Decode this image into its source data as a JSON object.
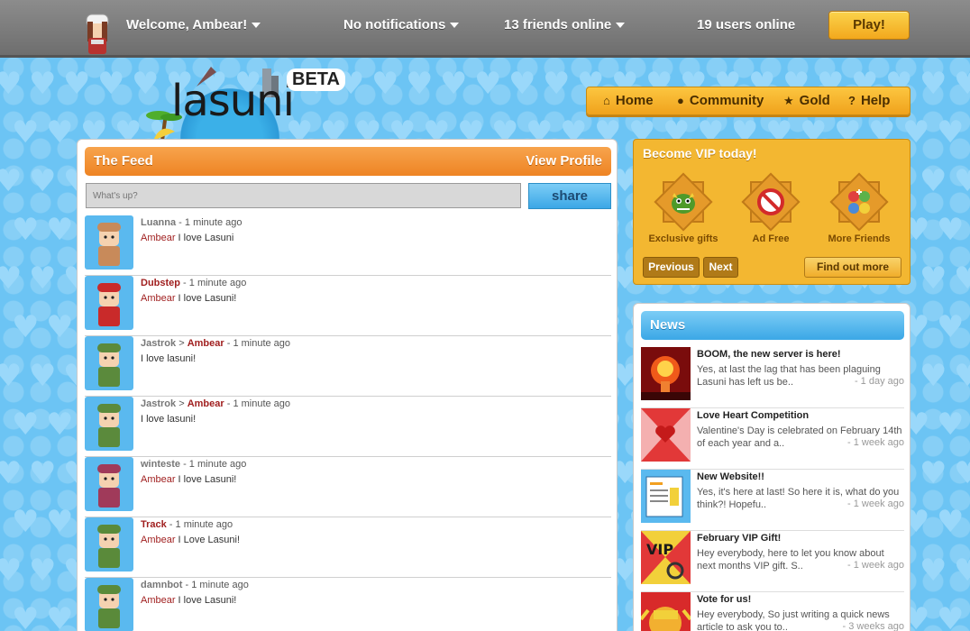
{
  "topbar": {
    "welcome": "Welcome, Ambear!",
    "notifications": "No notifications",
    "friends_online": "13 friends online",
    "users_online": "19 users online",
    "play_label": "Play!"
  },
  "logo": {
    "text": "lasuni",
    "badge": "BETA"
  },
  "nav": {
    "items": [
      {
        "label": "Home",
        "icon": "home-icon"
      },
      {
        "label": "Community",
        "icon": "person-icon"
      },
      {
        "label": "Gold",
        "icon": "star-icon"
      },
      {
        "label": "Help",
        "icon": "question-icon"
      }
    ]
  },
  "feed": {
    "title": "The Feed",
    "view_profile": "View Profile",
    "input_placeholder": "What's up?",
    "share_label": "share",
    "items": [
      {
        "author": "Luanna",
        "author_highlight": false,
        "to": "",
        "time": "1 minute ago",
        "recipient": "Ambear",
        "message": "I love Lasuni",
        "avatar_color": "#c88a5a"
      },
      {
        "author": "Dubstep",
        "author_highlight": true,
        "to": "",
        "time": "1 minute ago",
        "recipient": "Ambear",
        "message": "I love Lasuni!",
        "avatar_color": "#c92a2a"
      },
      {
        "author": "Jastrok",
        "author_highlight": false,
        "to": "Ambear",
        "time": "1 minute ago",
        "recipient": "",
        "message": "I love lasuni!",
        "avatar_color": "#5b8a3c"
      },
      {
        "author": "Jastrok",
        "author_highlight": false,
        "to": "Ambear",
        "time": "1 minute ago",
        "recipient": "",
        "message": "I love lasuni!",
        "avatar_color": "#5b8a3c"
      },
      {
        "author": "winteste",
        "author_highlight": false,
        "to": "",
        "time": "1 minute ago",
        "recipient": "Ambear",
        "message": "I love Lasuni!",
        "avatar_color": "#a03a5a"
      },
      {
        "author": "Track",
        "author_highlight": true,
        "to": "",
        "time": "1 minute ago",
        "recipient": "Ambear",
        "message": "I Love Lasuni!",
        "avatar_color": "#5a8a3a"
      },
      {
        "author": "damnbot",
        "author_highlight": false,
        "to": "",
        "time": "1 minute ago",
        "recipient": "Ambear",
        "message": "I love Lasuni!",
        "avatar_color": "#5a8a3a"
      }
    ]
  },
  "vip": {
    "title": "Become VIP today!",
    "items": [
      {
        "label": "Exclusive gifts",
        "icon": "dragon-icon"
      },
      {
        "label": "Ad Free",
        "icon": "no-ads-icon"
      },
      {
        "label": "More Friends",
        "icon": "friends-icon"
      }
    ],
    "previous_label": "Previous",
    "next_label": "Next",
    "find_out_label": "Find out more"
  },
  "news": {
    "title": "News",
    "items": [
      {
        "title": "BOOM, the new server is here!",
        "excerpt": "Yes, at last the lag that has been plaguing Lasuni has left us be..",
        "ago": "- 1 day ago",
        "thumb": "explosion-icon"
      },
      {
        "title": "Love Heart Competition",
        "excerpt": "Valentine's Day is celebrated on February 14th of each year and a..",
        "ago": "- 1 week ago",
        "thumb": "heart-icon"
      },
      {
        "title": "New Website!!",
        "excerpt": "Yes, it's here at last! So here it is, what do you think?! Hopefu..",
        "ago": "- 1 week ago",
        "thumb": "website-icon"
      },
      {
        "title": "February VIP Gift!",
        "excerpt": "Hey everybody, here to let you know about next months VIP gift. S..",
        "ago": "- 1 week ago",
        "thumb": "vip-gift-icon"
      },
      {
        "title": "Vote for us!",
        "excerpt": "Hey everybody, So just writing a quick news article to ask you to..",
        "ago": "- 3 weeks ago",
        "thumb": "vote-icon"
      }
    ]
  }
}
